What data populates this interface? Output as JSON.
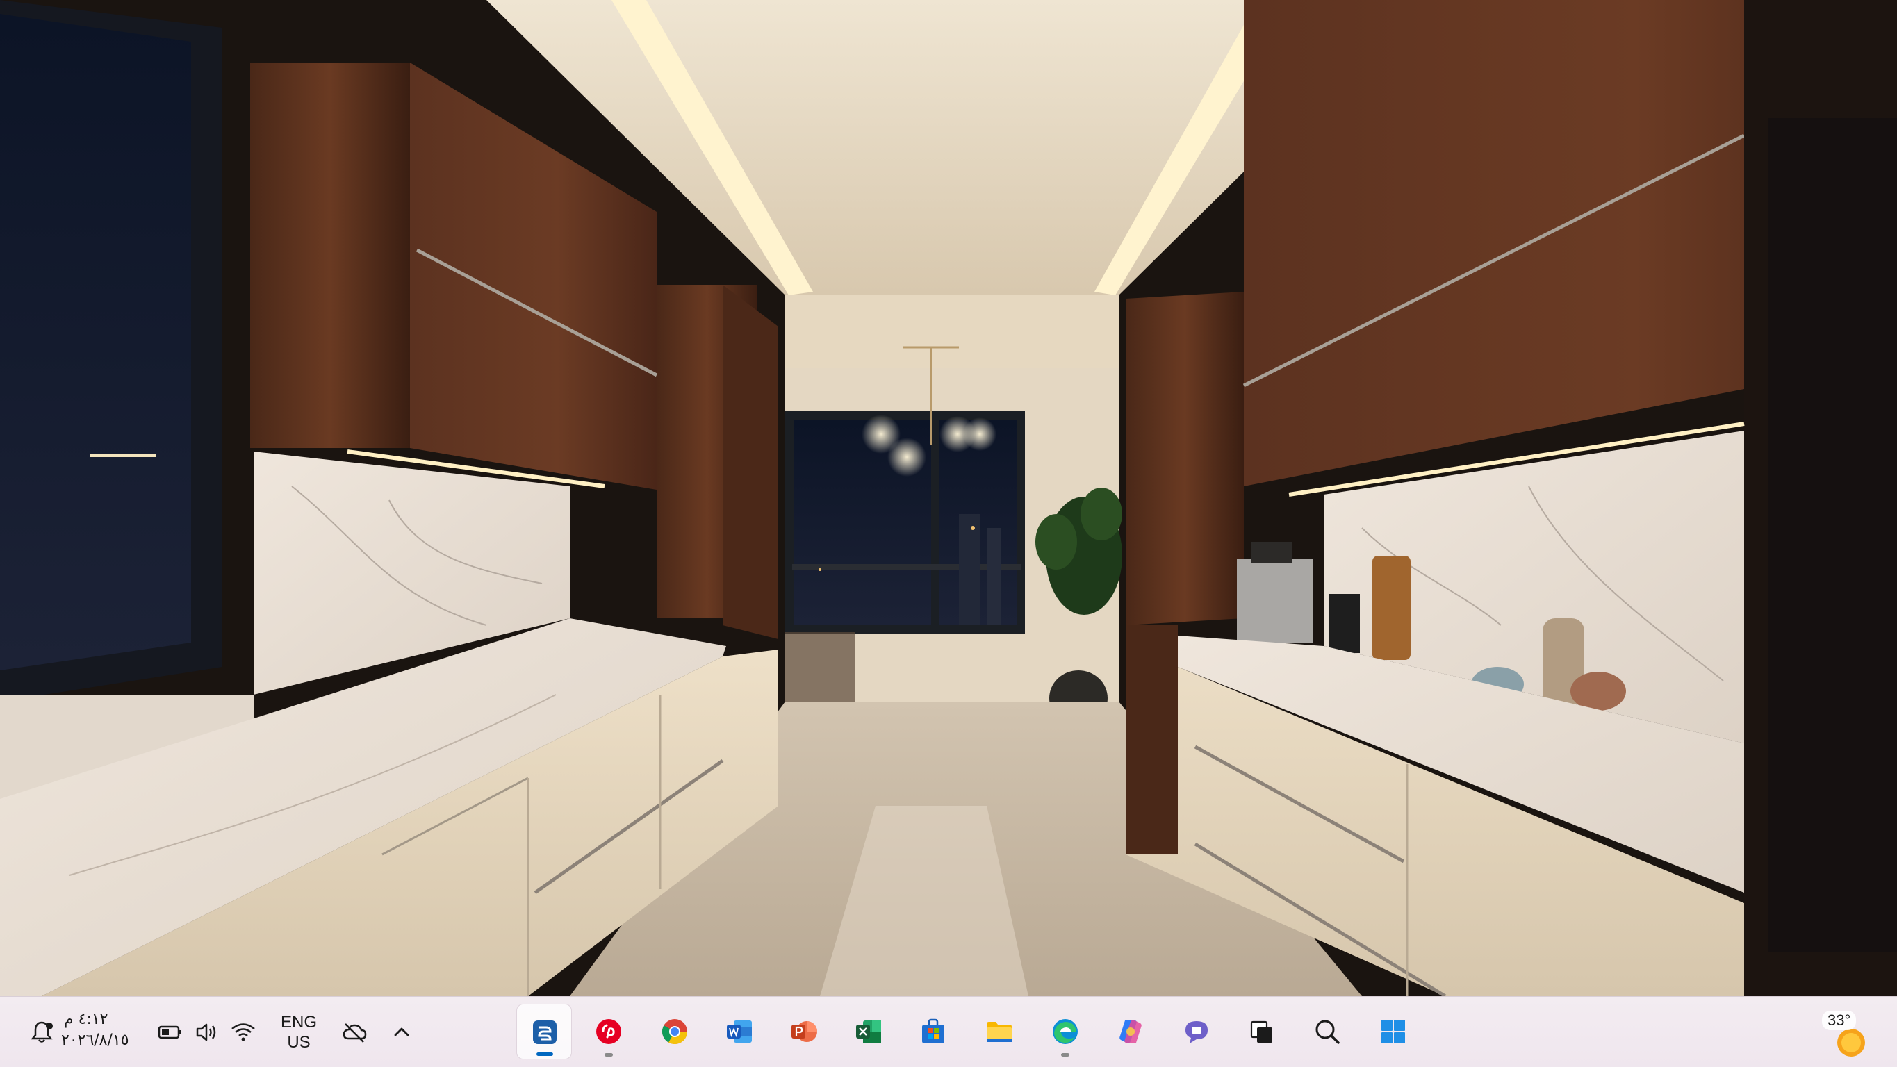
{
  "desktop": {
    "wallpaper": "galley-kitchen-night-photo"
  },
  "taskbar": {
    "clock": {
      "time": "٤:١٢ م",
      "date": "٢٠٢٦/٨/١٥"
    },
    "language": {
      "line1": "ENG",
      "line2": "US"
    },
    "tray_icons": [
      "notification-bell-icon",
      "battery-icon",
      "volume-icon",
      "wifi-icon",
      "cloud-off-icon",
      "chevron-up-icon"
    ],
    "pinned_apps": [
      {
        "name": "app-1",
        "icon": "app-1-icon",
        "active": true,
        "running": true
      },
      {
        "name": "pinterest",
        "icon": "pinterest-icon",
        "active": false,
        "running": true
      },
      {
        "name": "chrome",
        "icon": "chrome-icon",
        "active": false,
        "running": false
      },
      {
        "name": "word",
        "icon": "word-icon",
        "active": false,
        "running": false
      },
      {
        "name": "powerpoint",
        "icon": "powerpoint-icon",
        "active": false,
        "running": false
      },
      {
        "name": "excel",
        "icon": "excel-icon",
        "active": false,
        "running": false
      },
      {
        "name": "microsoft-store",
        "icon": "store-icon",
        "active": false,
        "running": false
      },
      {
        "name": "file-explorer",
        "icon": "folder-icon",
        "active": false,
        "running": false
      },
      {
        "name": "edge",
        "icon": "edge-icon",
        "active": false,
        "running": true
      },
      {
        "name": "copilot",
        "icon": "copilot-icon",
        "active": false,
        "running": false
      },
      {
        "name": "chat",
        "icon": "chat-icon",
        "active": false,
        "running": false
      },
      {
        "name": "task-view",
        "icon": "task-view-icon",
        "active": false,
        "running": false
      },
      {
        "name": "search",
        "icon": "search-icon",
        "active": false,
        "running": false
      },
      {
        "name": "start",
        "icon": "windows-start-icon",
        "active": false,
        "running": false
      }
    ],
    "weather": {
      "temperature": "33°",
      "icon": "sun-icon"
    }
  }
}
